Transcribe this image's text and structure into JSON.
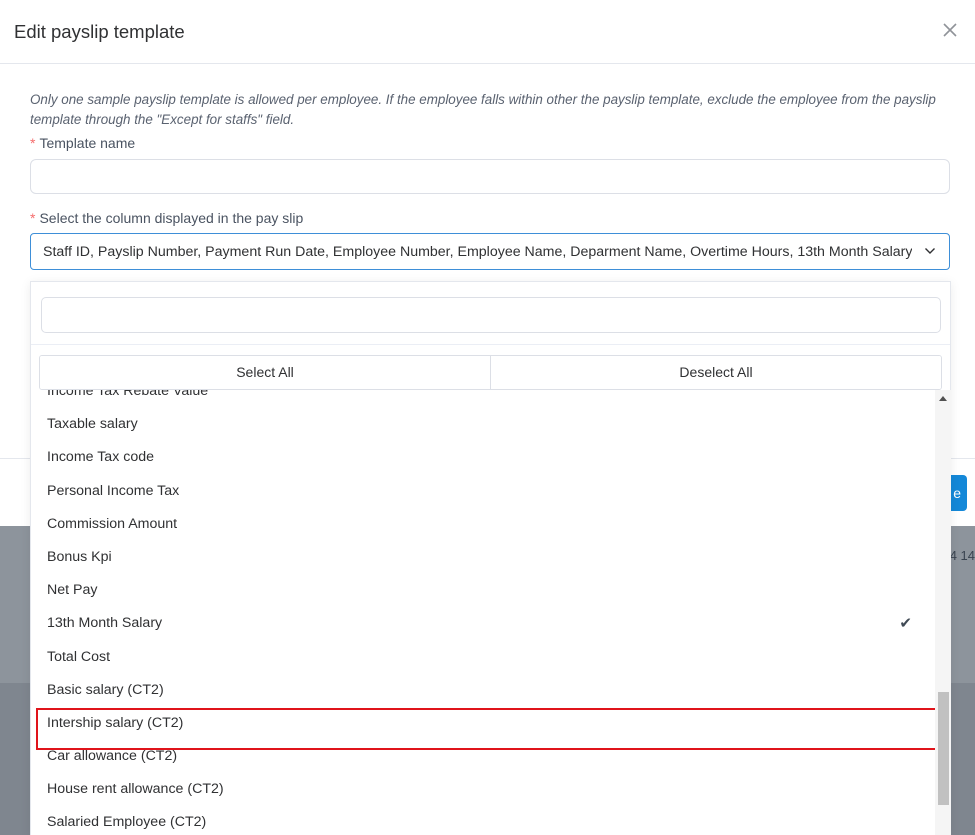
{
  "modal": {
    "title": "Edit payslip template",
    "close_icon": "close-icon",
    "note": "Only one sample payslip template is allowed per employee. If the employee falls within other the payslip template, exclude the employee from the payslip template through the \"Except for staffs\" field.",
    "template_name_label": "Template name",
    "template_name_value": "",
    "columns_label": "Select the column displayed in the pay slip",
    "columns_value": "Staff ID, Payslip Number, Payment Run Date, Employee Number, Employee Name, Deparment Name, Overtime Hours, 13th Month Salary",
    "required_mark": "*",
    "primary_button_fragment": "e",
    "accent_color": "#1488d8",
    "required_color": "#f56c6c"
  },
  "backdrop": {
    "partial_text": "4 14"
  },
  "dropdown": {
    "search_value": "",
    "select_all_label": "Select All",
    "deselect_all_label": "Deselect All",
    "partial_top_item": "Income Tax Rebate Value",
    "items": [
      {
        "label": "Taxable salary",
        "selected": false
      },
      {
        "label": "Income Tax code",
        "selected": false
      },
      {
        "label": "Personal Income Tax",
        "selected": false
      },
      {
        "label": "Commission Amount",
        "selected": false
      },
      {
        "label": "Bonus Kpi",
        "selected": false
      },
      {
        "label": "Net Pay",
        "selected": false
      },
      {
        "label": "13th Month Salary",
        "selected": true
      },
      {
        "label": "Total Cost",
        "selected": false
      },
      {
        "label": "Basic salary (CT2)",
        "selected": false
      },
      {
        "label": "Intership salary (CT2)",
        "selected": false
      },
      {
        "label": "Car allowance (CT2)",
        "selected": false
      },
      {
        "label": "House rent allowance (CT2)",
        "selected": false
      },
      {
        "label": "Salaried Employee (CT2)",
        "selected": false
      }
    ],
    "check_icon": "check-icon",
    "highlight_color": "#e0141b"
  }
}
